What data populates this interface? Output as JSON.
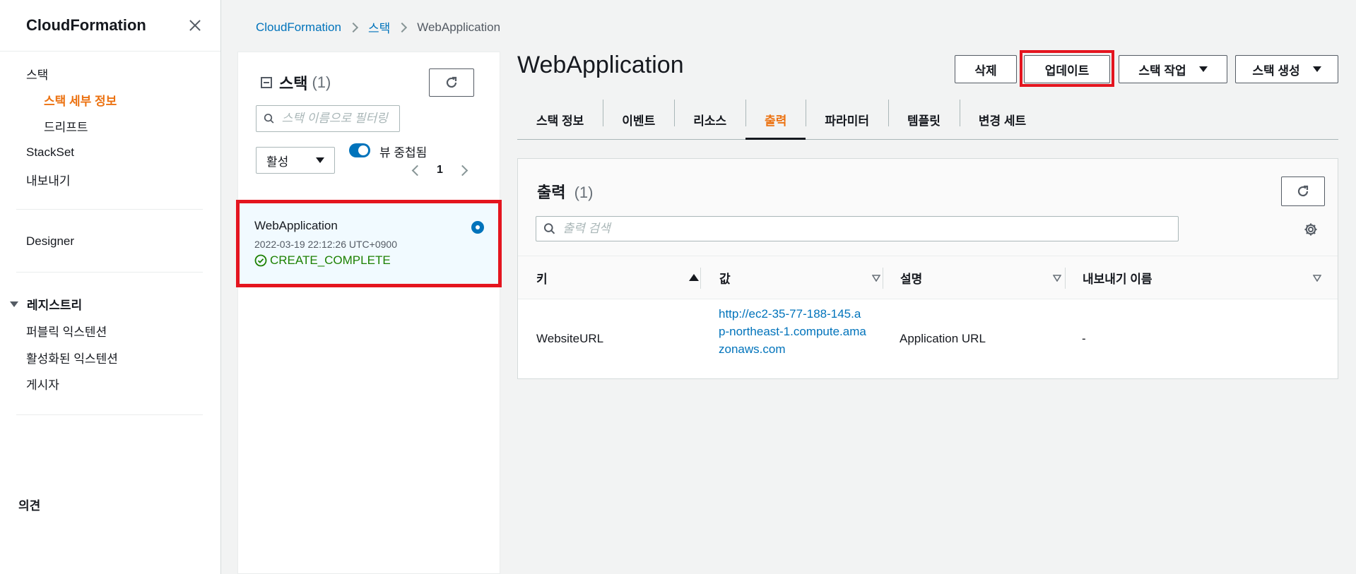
{
  "sidebar": {
    "title": "CloudFormation",
    "items": [
      {
        "label": "스택"
      },
      {
        "label": "스택 세부 정보"
      },
      {
        "label": "드리프트"
      },
      {
        "label": "StackSet"
      },
      {
        "label": "내보내기"
      },
      {
        "label": "Designer"
      },
      {
        "label": "레지스트리"
      },
      {
        "label": "퍼블릭 익스텐션"
      },
      {
        "label": "활성화된 익스텐션"
      },
      {
        "label": "게시자"
      },
      {
        "label": "의견"
      }
    ]
  },
  "breadcrumb": [
    "CloudFormation",
    "스택",
    "WebApplication"
  ],
  "stack_list": {
    "title": "스택",
    "count": "(1)",
    "filter_placeholder": "스택 이름으로 필터링",
    "status_filter": "활성",
    "toggle_label": "뷰 중첩됨",
    "page": "1",
    "stacks": [
      {
        "name": "WebApplication",
        "date": "2022-03-19 22:12:26 UTC+0900",
        "status": "CREATE_COMPLETE"
      }
    ]
  },
  "detail": {
    "title": "WebApplication",
    "buttons": {
      "delete": "삭제",
      "update": "업데이트",
      "stack_actions": "스택 작업",
      "create_stack": "스택 생성"
    },
    "tabs": [
      "스택 정보",
      "이벤트",
      "리소스",
      "출력",
      "파라미터",
      "템플릿",
      "변경 세트"
    ],
    "active_tab": "출력"
  },
  "outputs": {
    "title": "출력",
    "count": "(1)",
    "search_placeholder": "출력 검색",
    "columns": [
      "키",
      "값",
      "설명",
      "내보내기 이름"
    ],
    "rows": [
      {
        "key": "WebsiteURL",
        "value": "http://ec2-35-77-188-145.ap-northeast-1.compute.amazonaws.com",
        "description": "Application URL",
        "export_name": "-"
      }
    ]
  },
  "colors": {
    "accent_orange": "#ec7211",
    "link_blue": "#0073bb",
    "success_green": "#1d8102",
    "highlight_red": "#e4151f"
  }
}
